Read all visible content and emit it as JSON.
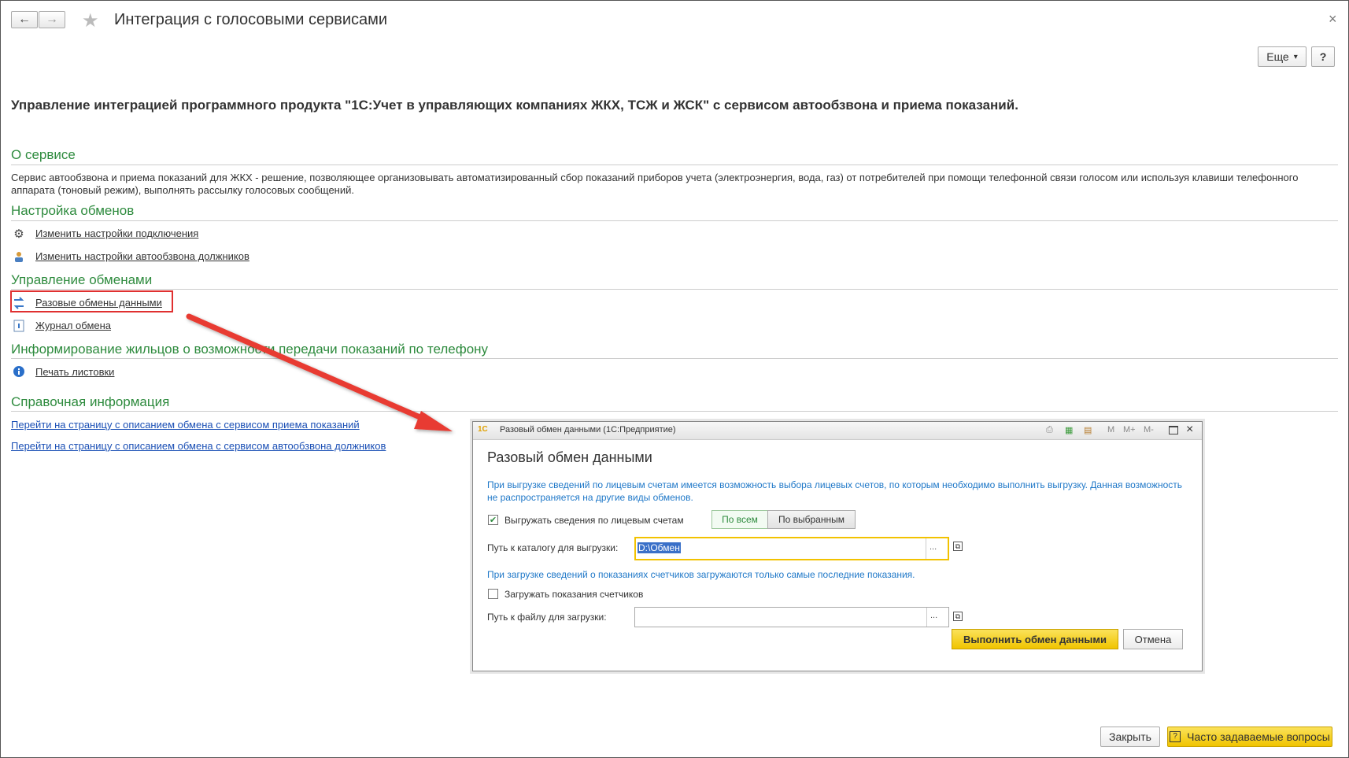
{
  "header": {
    "back_icon": "←",
    "forward_icon": "→",
    "favorite_icon": "★",
    "title": "Интеграция с голосовыми сервисами",
    "more_label": "Еще",
    "more_arrow": "▾",
    "help_label": "?",
    "close_icon": "×"
  },
  "main": {
    "heading": "Управление интеграцией программного продукта \"1С:Учет в управляющих компаниях ЖКХ, ТСЖ и ЖСК\" с сервисом автообзвона и приема показаний.",
    "about_title": "О сервисе",
    "about_text": "Сервис автообзвона и приема показаний для ЖКХ - решение, позволяющее организовывать автоматизированный сбор показаний приборов учета (электроэнергия, вода, газ) от потребителей при помощи телефонной связи голосом или используя клавиши телефонного аппарата (тоновый режим), выполнять рассылку голосовых сообщений.",
    "settings_title": "Настройка обменов",
    "settings_links": [
      "Изменить настройки подключения",
      "Изменить настройки автообзвона должников"
    ],
    "exchange_title": "Управление обменами",
    "exchange_links": [
      "Разовые обмены данными",
      "Журнал обмена"
    ],
    "inform_title": "Информирование жильцов о возможности передачи показаний по телефону",
    "inform_link": "Печать листовки",
    "reference_title": "Справочная информация",
    "reference_links": [
      "Перейти на страницу с описанием обмена с сервисом приема показаний",
      "Перейти на страницу с описанием обмена с сервисом автообзвона должников"
    ]
  },
  "dialog": {
    "logo": "1С",
    "window_title": "Разовый обмен данными  (1С:Предприятие)",
    "toolbar_icons": [
      "M",
      "M+",
      "M-"
    ],
    "heading": "Разовый обмен данными",
    "export_info": "При выгрузке сведений по лицевым счетам имеется возможность выбора лицевых счетов, по которым необходимо выполнить выгрузку. Данная возможность не распространяется на другие виды обменов.",
    "export_checkbox_label": "Выгружать сведения по лицевым счетам",
    "export_checked": true,
    "toggle_all": "По всем",
    "toggle_selected": "По выбранным",
    "export_path_label": "Путь к каталогу для выгрузки:",
    "export_path_value": "D:\\Обмен",
    "import_info": "При загрузке сведений о показаниях счетчиков загружаются только самые последние показания.",
    "import_checkbox_label": "Загружать показания счетчиков",
    "import_checked": false,
    "import_path_label": "Путь к файлу для загрузки:",
    "import_path_value": "",
    "dots": "...",
    "execute_label": "Выполнить обмен данными",
    "cancel_label": "Отмена"
  },
  "footer": {
    "close_label": "Закрыть",
    "faq_label": "Часто задаваемые вопросы",
    "faq_icon": "?"
  },
  "colors": {
    "section_green": "#2e8b3e",
    "link_blue": "#1a4fb5",
    "info_blue": "#1f78c8",
    "highlight_red": "#e03030",
    "arrow_red": "#e83a30",
    "yellow_button": "#f6d21a"
  }
}
